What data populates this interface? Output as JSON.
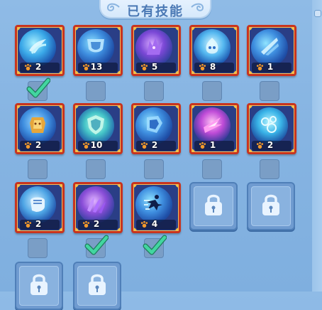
{
  "title": {
    "text": "已有技能"
  },
  "colors": {
    "background": "#86b4e2",
    "card_border": "#c8341f",
    "card_corner": "#f2c04c",
    "check": "#3ecf9a",
    "lock_slot": "#6f9bd0"
  },
  "skills": [
    {
      "icon": "claw-icon",
      "level": "2",
      "checked": true
    },
    {
      "icon": "horn-shield-icon",
      "level": "13",
      "checked": false
    },
    {
      "icon": "purple-beast-icon",
      "level": "5",
      "checked": false
    },
    {
      "icon": "water-spirit-icon",
      "level": "8",
      "checked": false
    },
    {
      "icon": "slash-icon",
      "level": "1",
      "checked": false
    },
    {
      "icon": "golden-armor-icon",
      "level": "2",
      "checked": false
    },
    {
      "icon": "shield-icon",
      "level": "10",
      "checked": false
    },
    {
      "icon": "crystal-armor-icon",
      "level": "2",
      "checked": false
    },
    {
      "icon": "pink-blade-icon",
      "level": "1",
      "checked": false
    },
    {
      "icon": "bubble-icon",
      "level": "2",
      "checked": false
    },
    {
      "icon": "fist-icon",
      "level": "2",
      "checked": false
    },
    {
      "icon": "purple-claw-icon",
      "level": "2",
      "checked": true
    },
    {
      "icon": "dash-icon",
      "level": "4",
      "checked": true
    }
  ],
  "locked_slots": [
    {
      "icon": "lock-icon"
    },
    {
      "icon": "lock-icon"
    },
    {
      "icon": "lock-icon"
    },
    {
      "icon": "lock-icon"
    }
  ]
}
